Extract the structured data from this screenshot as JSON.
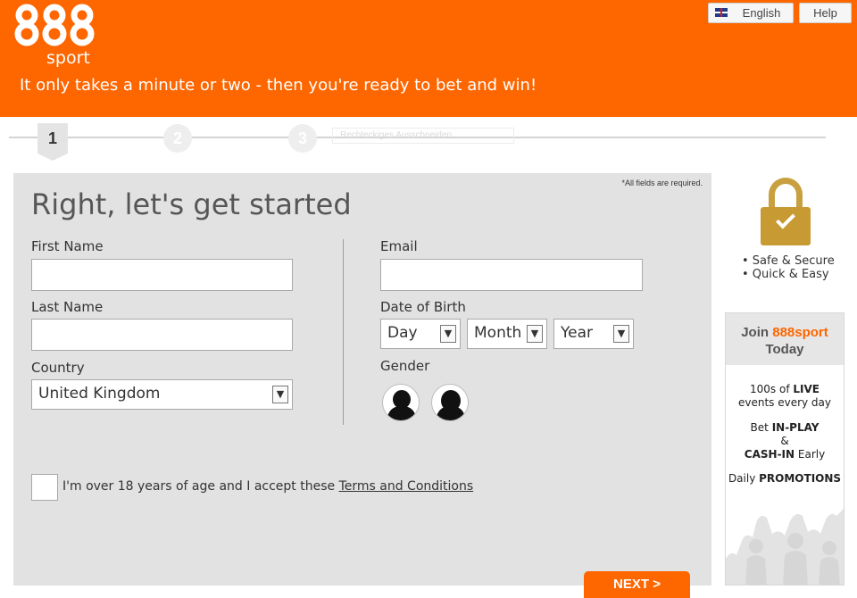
{
  "header": {
    "logo_number": "888",
    "logo_sub": "sport",
    "tagline": "It only takes a minute or two - then you're ready to bet and win!",
    "language_label": "English",
    "help_label": "Help",
    "colors": {
      "brand": "#fe6600"
    }
  },
  "steps": {
    "items": [
      {
        "number": "1"
      },
      {
        "number": "2"
      },
      {
        "number": "3"
      }
    ],
    "ghost_text": "Rechteckiges Ausschneiden"
  },
  "form": {
    "required_note": "*All fields are required.",
    "title": "Right, let's get started",
    "first_name_label": "First Name",
    "last_name_label": "Last Name",
    "country_label": "Country",
    "country_value": "United Kingdom",
    "email_label": "Email",
    "dob_label": "Date of Birth",
    "day_value": "Day",
    "month_value": "Month",
    "year_value": "Year",
    "gender_label": "Gender",
    "terms_prefix": "I'm over 18 years of age and I accept these ",
    "terms_link": "Terms and Conditions",
    "next_label": "NEXT >"
  },
  "sidebar": {
    "secure_1": "• Safe & Secure",
    "secure_2": "• Quick & Easy",
    "promo_join": "Join ",
    "promo_brand": "888sport",
    "promo_today": "Today",
    "promo_events_pre": "100s of ",
    "promo_events_bold": "LIVE",
    "promo_events_post": " events every day",
    "promo_bet_pre": "Bet ",
    "promo_bet_bold": "IN-PLAY",
    "promo_amp": "&",
    "promo_cash_bold": "CASH-IN",
    "promo_cash_post": " Early",
    "promo_daily_pre": "Daily ",
    "promo_daily_bold": "PROMOTIONS"
  }
}
